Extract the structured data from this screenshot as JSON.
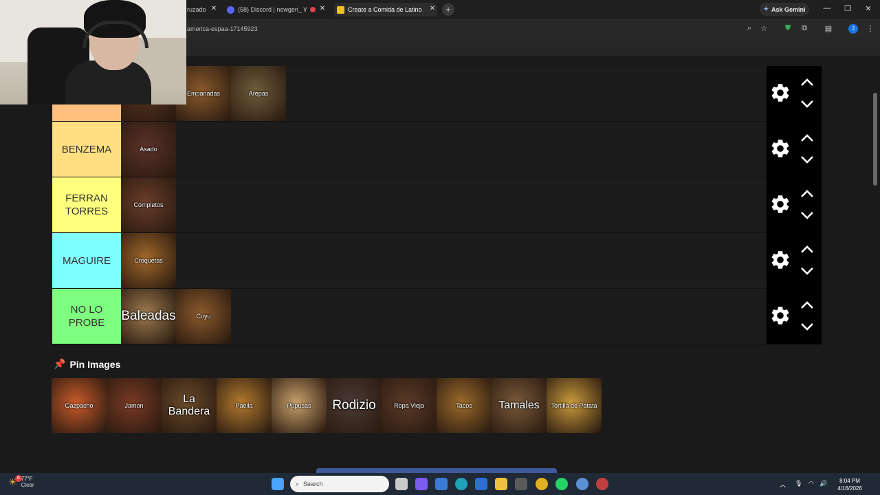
{
  "browser": {
    "tabs": [
      {
        "label": "ruzado"
      },
      {
        "label": "(58) Discord | newgen_ W"
      },
      {
        "label": "Create a Comida de Latino Am"
      }
    ],
    "new_tab": "+",
    "ask_gemini": "Ask Gemini",
    "url": "america-espaa-17145923",
    "profile_initial": "J"
  },
  "tiers": [
    {
      "label": "",
      "color": "#ffbf7f",
      "items": [
        {
          "label": "",
          "bg": "#5a3320"
        },
        {
          "label": "Empanadas",
          "bg": "#8a5a2b"
        },
        {
          "label": "Arepas",
          "bg": "#6f5d3b"
        }
      ]
    },
    {
      "label": "BENZEMA",
      "color": "#ffdf7f",
      "items": [
        {
          "label": "Asado",
          "bg": "#5b3129"
        }
      ]
    },
    {
      "label": "FERRAN TORRES",
      "color": "#ffff7f",
      "items": [
        {
          "label": "Completos",
          "bg": "#6a3d2a"
        }
      ]
    },
    {
      "label": "MAGUIRE",
      "color": "#7fffff",
      "items": [
        {
          "label": "Croquetas",
          "bg": "#a0682a"
        }
      ]
    },
    {
      "label": "NO LO PROBE",
      "color": "#7fff7f",
      "items": [
        {
          "label": "Baleadas",
          "bg": "#9c7a4e"
        },
        {
          "label": "Cuyu",
          "bg": "#8b5a2c"
        }
      ]
    }
  ],
  "pin": {
    "title": "Pin Images",
    "items": [
      {
        "label": "Gazpacho",
        "bg": "#c85a2a"
      },
      {
        "label": "Jamon",
        "bg": "#7a3a24"
      },
      {
        "label": "La Bandera",
        "bg": "#6a4a2a"
      },
      {
        "label": "Paella",
        "bg": "#b27a2e"
      },
      {
        "label": "Pupusas",
        "bg": "#c8a06a"
      },
      {
        "label": "Rodizio",
        "bg": "#4a3a34"
      },
      {
        "label": "Ropa Vieja",
        "bg": "#5a3a28"
      },
      {
        "label": "Tacos",
        "bg": "#9a6a2a"
      },
      {
        "label": "Tamales",
        "bg": "#7a5a3a"
      },
      {
        "label": "Tortilla de Patata",
        "bg": "#c89a3a"
      }
    ]
  },
  "taskbar": {
    "temperature": "77°F",
    "condition": "Clear",
    "search_placeholder": "Search",
    "time": "8:04 PM",
    "date": "4/16/2026",
    "weather_badge": "6"
  }
}
